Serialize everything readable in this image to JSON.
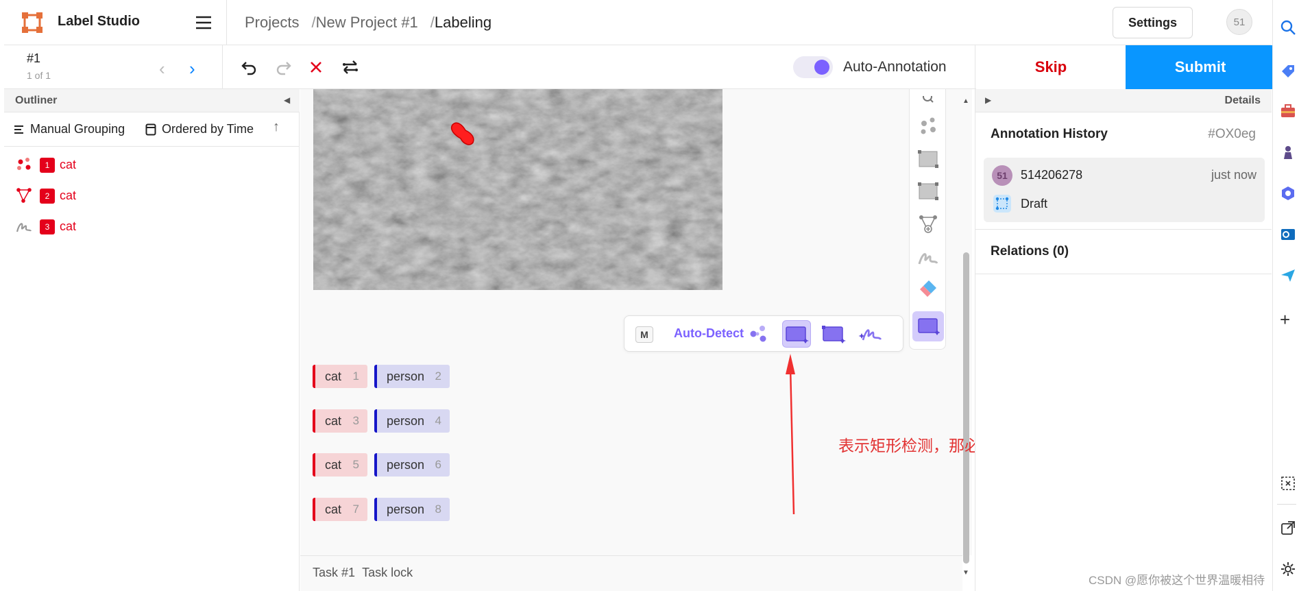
{
  "app": {
    "brand": "Label Studio",
    "avatar_initials": "51"
  },
  "breadcrumbs": {
    "projects": "Projects",
    "sep": "/",
    "project": "New Project #1",
    "current": "Labeling"
  },
  "header": {
    "settings_label": "Settings"
  },
  "toolbar": {
    "task_id": "#1",
    "task_count": "1 of 1",
    "prev": "‹",
    "next": "›",
    "auto_annotation_label": "Auto-Annotation",
    "auto_annotation_on": true,
    "skip_label": "Skip",
    "submit_label": "Submit"
  },
  "outliner": {
    "title": "Outliner",
    "grouping_label": "Manual Grouping",
    "ordering_label": "Ordered by Time",
    "regions": [
      {
        "num": "1",
        "label": "cat",
        "icon": "keypoints-icon"
      },
      {
        "num": "2",
        "label": "cat",
        "icon": "polygon-icon"
      },
      {
        "num": "3",
        "label": "cat",
        "icon": "brush-icon"
      }
    ]
  },
  "autodetect": {
    "key": "M",
    "label": "Auto-Detect"
  },
  "label_chips": [
    {
      "name": "cat",
      "hotkey": "1"
    },
    {
      "name": "person",
      "hotkey": "2"
    },
    {
      "name": "cat",
      "hotkey": "3"
    },
    {
      "name": "person",
      "hotkey": "4"
    },
    {
      "name": "cat",
      "hotkey": "5"
    },
    {
      "name": "person",
      "hotkey": "6"
    },
    {
      "name": "cat",
      "hotkey": "7"
    },
    {
      "name": "person",
      "hotkey": "8"
    }
  ],
  "annotation_note": "表示矩形检测，那必须用矩形标注",
  "bottom": {
    "task": "Task #1",
    "lock": "Task lock"
  },
  "details": {
    "title": "Details",
    "history_title": "Annotation History",
    "history_id": "#OX0eg",
    "user_initials": "51",
    "user": "514206278",
    "time": "just now",
    "status": "Draft",
    "relations": "Relations (0)"
  },
  "watermark": "CSDN @愿你被这个世界温暖相待",
  "colors": {
    "accent": "#0996ff",
    "cat": "#e4001b",
    "person": "#1515c8",
    "auto": "#7b61ff",
    "skip": "#d8000c"
  }
}
